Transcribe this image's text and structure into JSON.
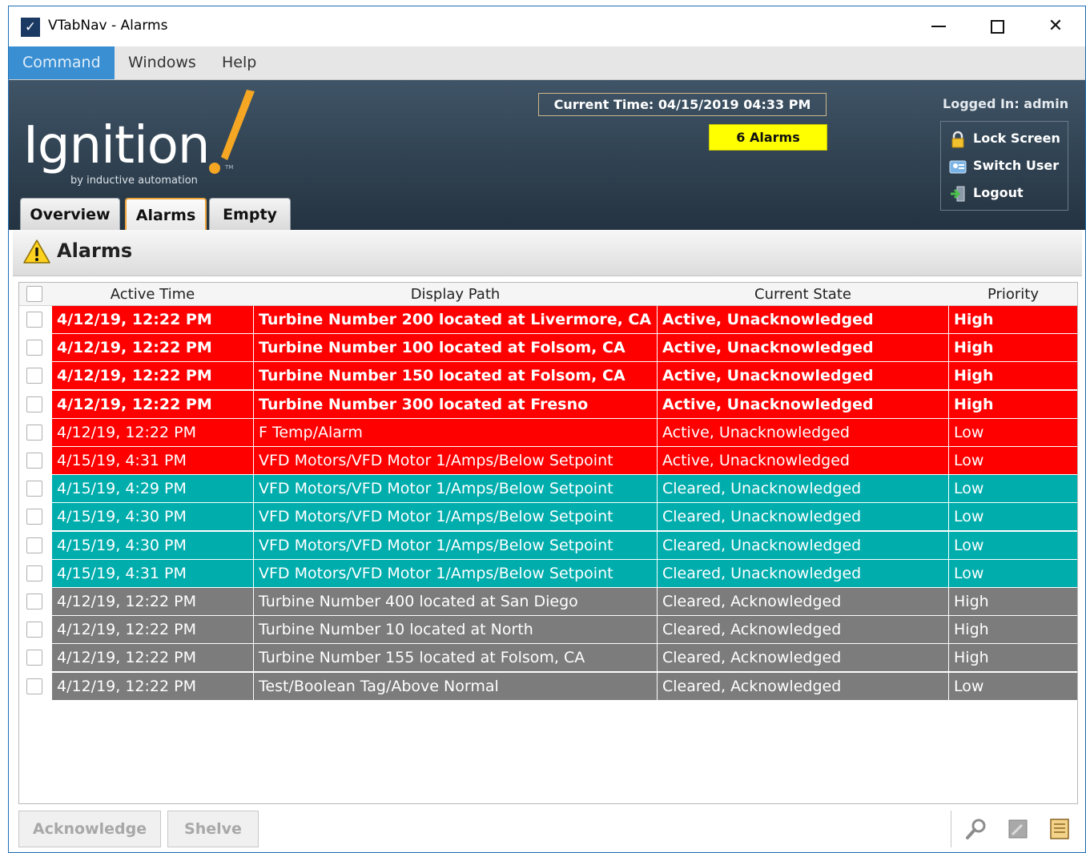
{
  "window": {
    "title": "VTabNav - Alarms",
    "controls": {
      "minimize": "minimize",
      "maximize": "maximize",
      "close": "✕"
    }
  },
  "menu": [
    "Command",
    "Windows",
    "Help"
  ],
  "header": {
    "logo_text": "Ignition",
    "logo_sub": "by inductive automation",
    "logo_tm": "TM",
    "current_time": "Current Time: 04/15/2019 04:33 PM",
    "alarm_count": "6 Alarms",
    "logged_in": "Logged In: admin",
    "user_actions": [
      "Lock Screen",
      "Switch User",
      "Logout"
    ],
    "tabs": [
      "Overview",
      "Alarms",
      "Empty"
    ]
  },
  "section": {
    "title": "Alarms"
  },
  "table": {
    "columns": [
      "Active Time",
      "Display Path",
      "Current State",
      "Priority"
    ],
    "rows": [
      {
        "time": "4/12/19, 12:22 PM",
        "path": "Turbine Number 200 located at Livermore, CA",
        "state": "Active, Unacknowledged",
        "priority": "High",
        "style": "active",
        "bold": true
      },
      {
        "time": "4/12/19, 12:22 PM",
        "path": "Turbine Number 100 located at Folsom, CA",
        "state": "Active, Unacknowledged",
        "priority": "High",
        "style": "active",
        "bold": true
      },
      {
        "time": "4/12/19, 12:22 PM",
        "path": "Turbine Number 150 located at Folsom, CA",
        "state": "Active, Unacknowledged",
        "priority": "High",
        "style": "active",
        "bold": true
      },
      {
        "time": "4/12/19, 12:22 PM",
        "path": "Turbine Number 300 located at Fresno",
        "state": "Active, Unacknowledged",
        "priority": "High",
        "style": "active",
        "bold": true
      },
      {
        "time": "4/12/19, 12:22 PM",
        "path": "F Temp/Alarm",
        "state": "Active, Unacknowledged",
        "priority": "Low",
        "style": "active",
        "bold": false
      },
      {
        "time": "4/15/19, 4:31 PM",
        "path": "VFD Motors/VFD Motor 1/Amps/Below Setpoint",
        "state": "Active, Unacknowledged",
        "priority": "Low",
        "style": "active",
        "bold": false
      },
      {
        "time": "4/15/19, 4:29 PM",
        "path": "VFD Motors/VFD Motor 1/Amps/Below Setpoint",
        "state": "Cleared, Unacknowledged",
        "priority": "Low",
        "style": "cleared-unack",
        "bold": false
      },
      {
        "time": "4/15/19, 4:30 PM",
        "path": "VFD Motors/VFD Motor 1/Amps/Below Setpoint",
        "state": "Cleared, Unacknowledged",
        "priority": "Low",
        "style": "cleared-unack",
        "bold": false
      },
      {
        "time": "4/15/19, 4:30 PM",
        "path": "VFD Motors/VFD Motor 1/Amps/Below Setpoint",
        "state": "Cleared, Unacknowledged",
        "priority": "Low",
        "style": "cleared-unack",
        "bold": false
      },
      {
        "time": "4/15/19, 4:31 PM",
        "path": "VFD Motors/VFD Motor 1/Amps/Below Setpoint",
        "state": "Cleared, Unacknowledged",
        "priority": "Low",
        "style": "cleared-unack",
        "bold": false
      },
      {
        "time": "4/12/19, 12:22 PM",
        "path": "Turbine Number 400 located at San Diego",
        "state": "Cleared, Acknowledged",
        "priority": "High",
        "style": "cleared-ack",
        "bold": false
      },
      {
        "time": "4/12/19, 12:22 PM",
        "path": "Turbine Number 10 located at North",
        "state": "Cleared, Acknowledged",
        "priority": "High",
        "style": "cleared-ack",
        "bold": false
      },
      {
        "time": "4/12/19, 12:22 PM",
        "path": "Turbine Number 155 located at Folsom, CA",
        "state": "Cleared, Acknowledged",
        "priority": "High",
        "style": "cleared-ack",
        "bold": false
      },
      {
        "time": "4/12/19, 12:22 PM",
        "path": "Test/Boolean Tag/Above Normal",
        "state": "Cleared, Acknowledged",
        "priority": "Low",
        "style": "cleared-ack",
        "bold": false
      }
    ]
  },
  "row_colors": {
    "active": "#ff0000",
    "cleared-unack": "#00adad",
    "cleared-ack": "#7c7c7c"
  },
  "footer": {
    "acknowledge": "Acknowledge",
    "shelve": "Shelve",
    "icons": [
      "search-icon",
      "edit-icon",
      "notes-icon"
    ]
  }
}
